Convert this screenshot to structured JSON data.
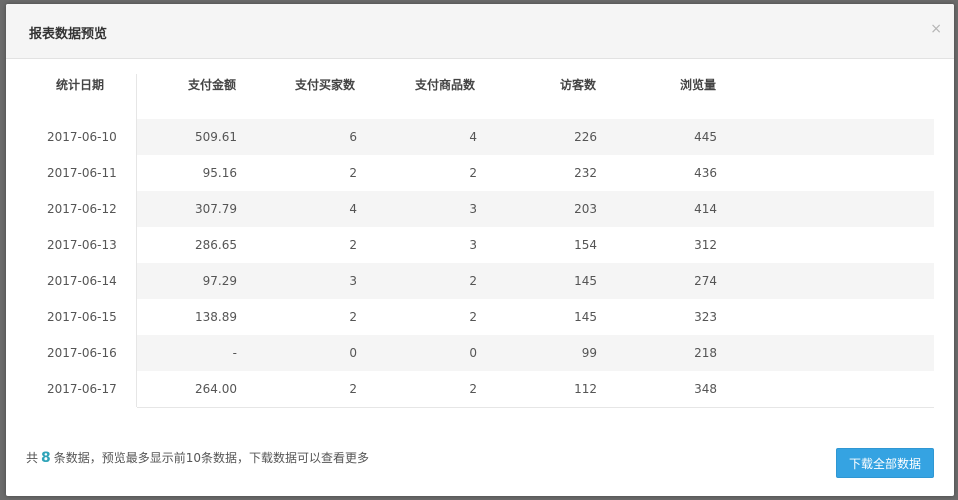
{
  "dialog": {
    "title": "报表数据预览",
    "close_glyph": "×"
  },
  "table": {
    "columns": [
      "统计日期",
      "支付金额",
      "支付买家数",
      "支付商品数",
      "访客数",
      "浏览量"
    ],
    "rows": [
      [
        "2017-06-10",
        "509.61",
        "6",
        "4",
        "226",
        "445"
      ],
      [
        "2017-06-11",
        "95.16",
        "2",
        "2",
        "232",
        "436"
      ],
      [
        "2017-06-12",
        "307.79",
        "4",
        "3",
        "203",
        "414"
      ],
      [
        "2017-06-13",
        "286.65",
        "2",
        "3",
        "154",
        "312"
      ],
      [
        "2017-06-14",
        "97.29",
        "3",
        "2",
        "145",
        "274"
      ],
      [
        "2017-06-15",
        "138.89",
        "2",
        "2",
        "145",
        "323"
      ],
      [
        "2017-06-16",
        "-",
        "0",
        "0",
        "99",
        "218"
      ],
      [
        "2017-06-17",
        "264.00",
        "2",
        "2",
        "112",
        "348"
      ]
    ]
  },
  "footer": {
    "prefix": "共",
    "count": "8",
    "suffix": "条数据，预览最多显示前10条数据，下载数据可以查看更多",
    "download_label": "下载全部数据"
  },
  "colors": {
    "accent": "#35a3e2",
    "count_highlight": "#2fa4b8"
  },
  "icons": {
    "close": "close-icon"
  }
}
